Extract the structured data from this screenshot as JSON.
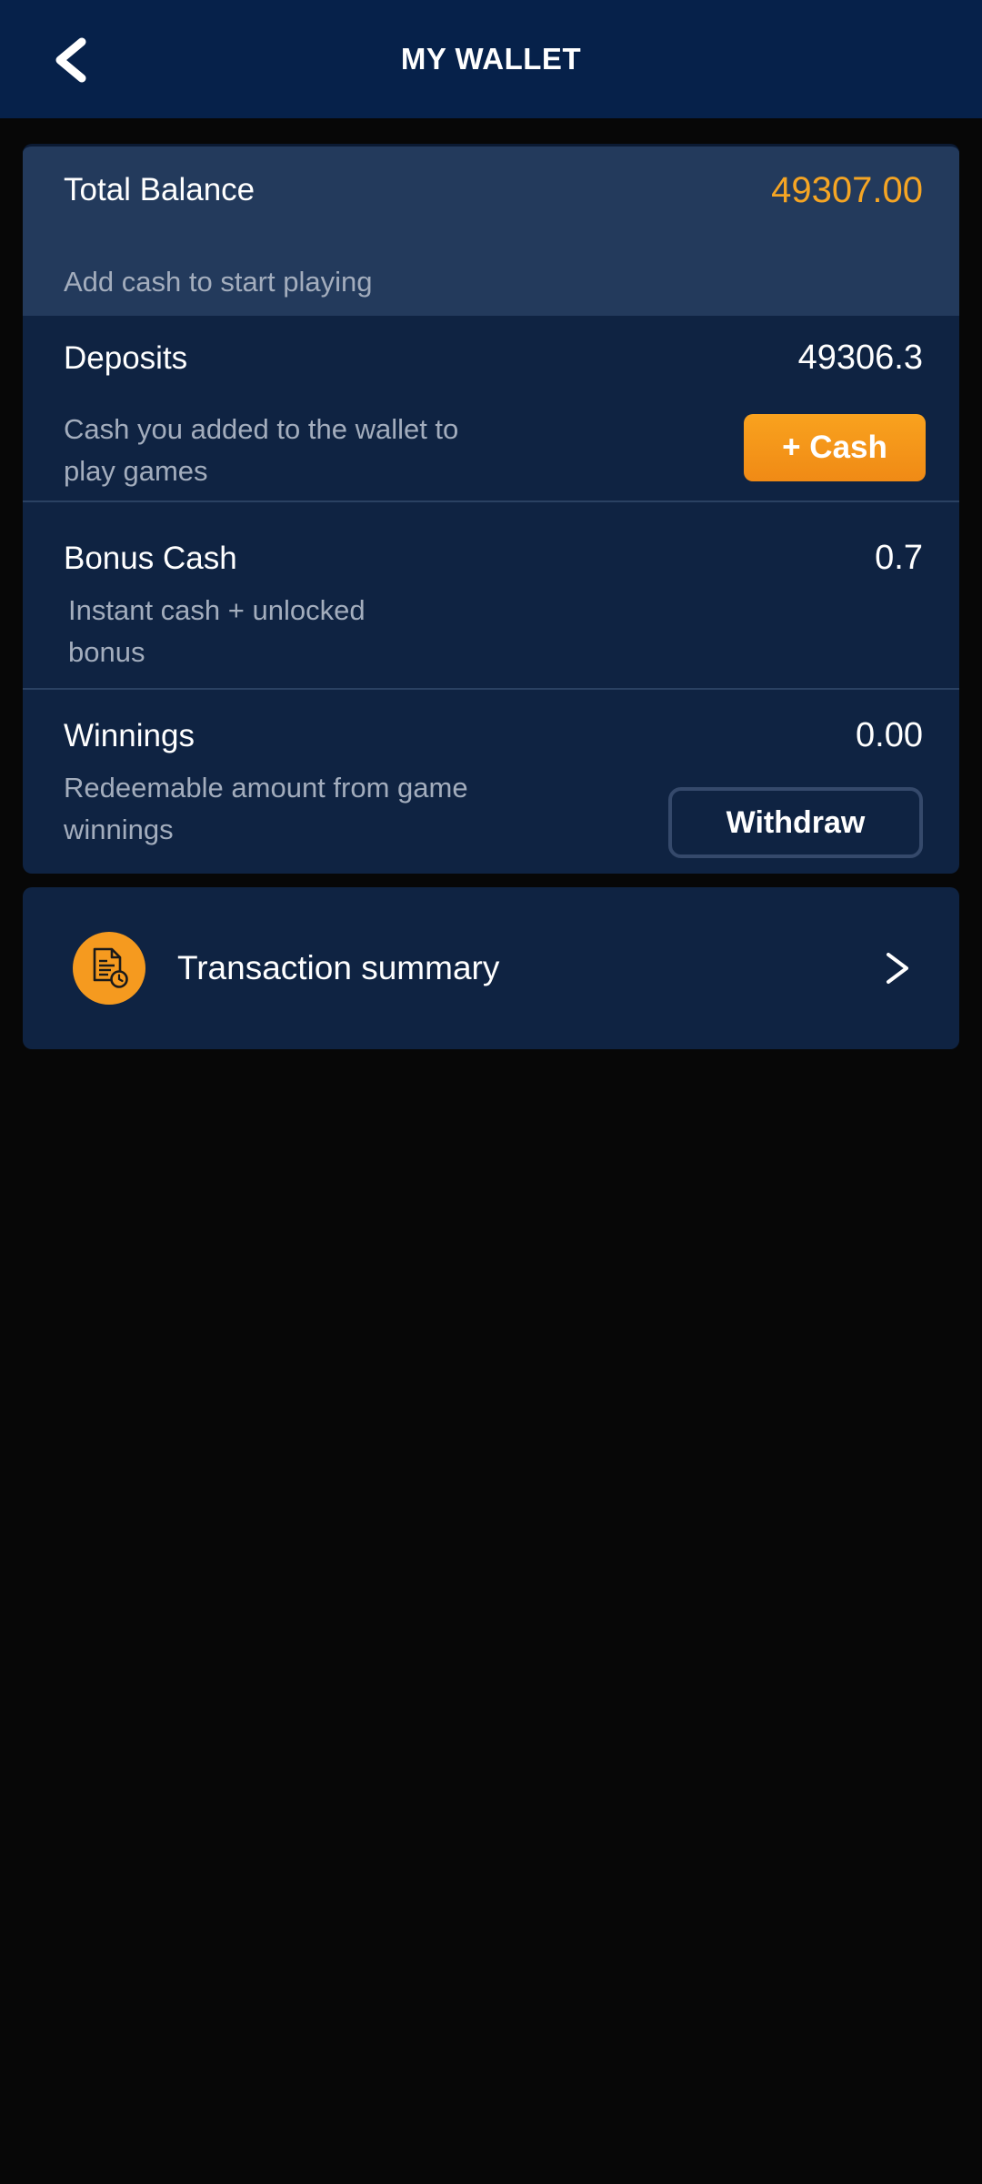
{
  "header": {
    "title": "MY WALLET",
    "back_icon": "chevron-left-icon"
  },
  "wallet": {
    "total": {
      "label": "Total Balance",
      "amount": "49307.00",
      "amount_color": "#f5a524",
      "subtitle": "Add cash to start playing"
    },
    "deposits": {
      "label": "Deposits",
      "amount": "49306.3",
      "desc_line1": "Cash you added to the wallet to",
      "desc_line2": "play games",
      "button_label": "+ Cash"
    },
    "bonus": {
      "label": "Bonus Cash",
      "amount": "0.7",
      "desc_line1": "Instant cash + unlocked",
      "desc_line2": "bonus"
    },
    "winnings": {
      "label": "Winnings",
      "amount": "0.00",
      "desc_line1": "Redeemable amount from game",
      "desc_line2": "winnings",
      "button_label": "Withdraw"
    }
  },
  "transactions": {
    "label": "Transaction summary",
    "icon": "document-clock-icon",
    "chevron_icon": "chevron-right-icon"
  },
  "colors": {
    "header_bg": "#06214a",
    "card_bg": "#0f2342",
    "total_bg": "#233a5c",
    "accent_orange": "#f59a1f",
    "page_bg": "#070707"
  }
}
